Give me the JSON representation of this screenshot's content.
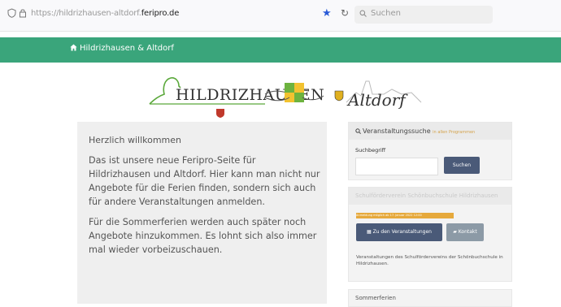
{
  "browser": {
    "url_prefix": "https://hildrizhausen-altdorf.",
    "url_domain": "feripro.de",
    "search_placeholder": "Suchen"
  },
  "navbar": {
    "brand": "Hildrizhausen & Altdorf"
  },
  "logo": {
    "left_name": "HILDRIZHAUSEN",
    "right_name": "Altdorf"
  },
  "welcome": {
    "title": "Herzlich willkommen",
    "paragraph1": "Das ist unsere neue Feripro-Seite für Hildrizhausen und Altdorf. Hier kann man nicht nur Angebote für die Ferien finden, sondern sich auch für andere Veranstaltungen anmelden.",
    "paragraph2": "Für die Sommerferien werden auch später noch Angebote hinzukommen. Es lohnt sich also immer mal wieder vorbeizuschauen."
  },
  "search_panel": {
    "title": "Veranstaltungssuche",
    "title_small": "in allen Programmen",
    "label": "Suchbegriff",
    "button": "Suchen"
  },
  "event_panel": {
    "header": "Schulförderverein Schönbuchschule Hildrizhausen",
    "badge": "Anmeldung möglich ab 17. Januar 2022 12:00",
    "button_events": "Zu den Veranstaltungen",
    "button_contact": "Kontakt",
    "description": "Veranstaltungen des Schulfördervereins der Schönbuchschule in Hildrizhausen."
  },
  "summer_panel": {
    "title": "Sommerferien"
  },
  "colors": {
    "nav_green": "#3aa57b",
    "button_navy": "#4a5a78",
    "badge_orange": "#e6a93c"
  }
}
